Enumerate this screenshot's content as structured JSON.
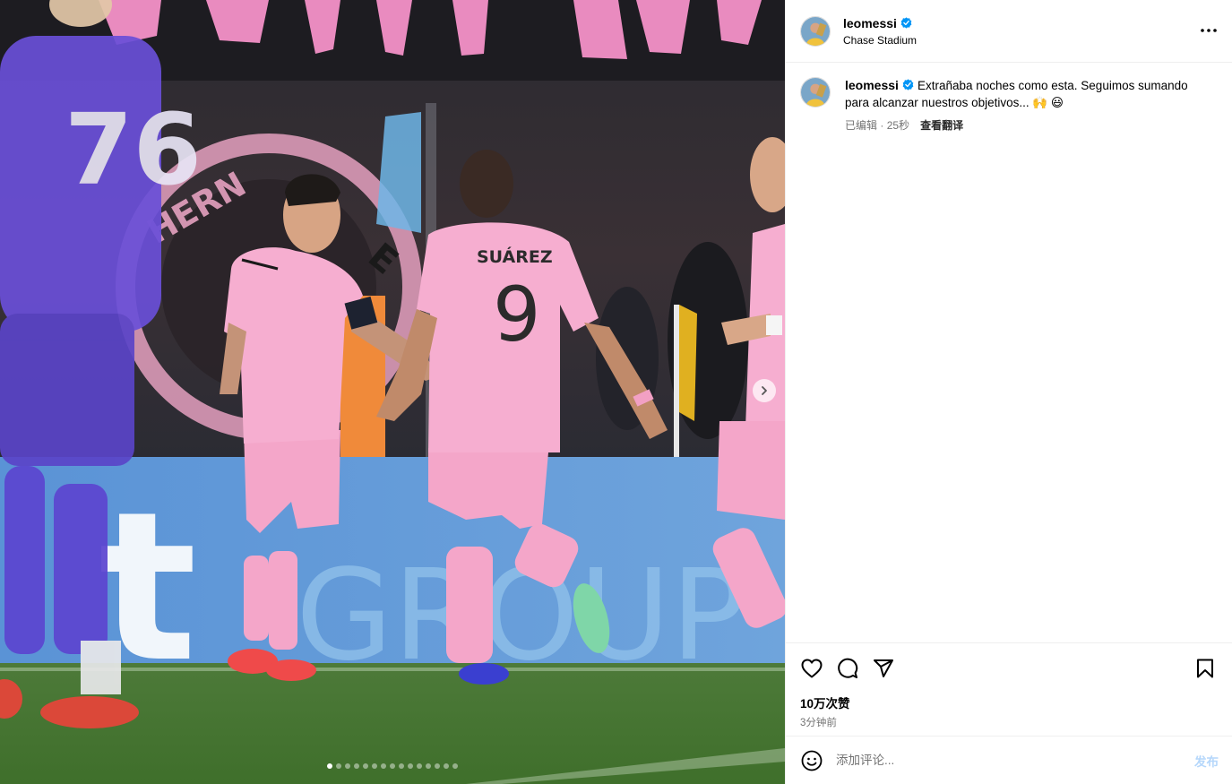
{
  "post": {
    "username": "leomessi",
    "location": "Chase Stadium",
    "caption": "Extrañaba noches como esta. Seguimos sumando para alcanzar nuestros objetivos... 🙌 😃",
    "edited_label": "已编辑",
    "time_ago": "25秒",
    "separator": "·",
    "translate_label": "查看翻译",
    "likes": "10万次赞",
    "posted_time": "3分钟前"
  },
  "media": {
    "jersey_number_front": "76",
    "jersey_name_back": "SUÁREZ",
    "jersey_number_back": "9",
    "banner_text_left": "t",
    "banner_text_right": "GROUP",
    "crest_text": "HERN",
    "crest_text_right": "E",
    "carousel": {
      "count": 15,
      "current": 1
    }
  },
  "comment_box": {
    "placeholder": "添加评论...",
    "post_label": "发布"
  },
  "icons": {
    "verified": "verified-badge-icon",
    "more": "more-options-icon",
    "like": "heart-icon",
    "comment": "comment-bubble-icon",
    "share": "paper-plane-icon",
    "save": "bookmark-icon",
    "emoji": "emoji-icon",
    "next": "chevron-right-icon"
  },
  "colors": {
    "verified_blue": "#0095f6",
    "jersey_pink": "#f4a6c9",
    "muted_text": "#737373",
    "post_button": "#b5d7fb"
  }
}
